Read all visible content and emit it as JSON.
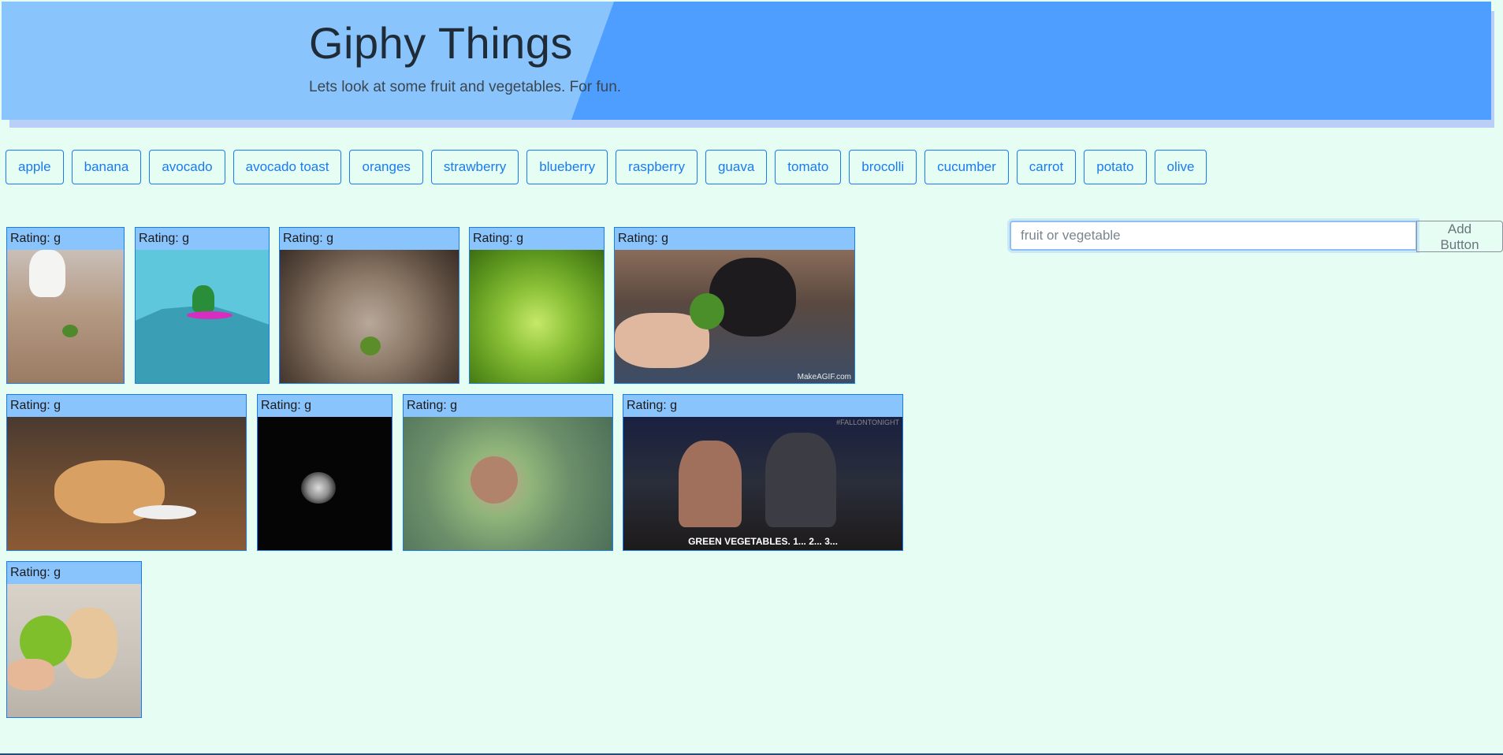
{
  "header": {
    "title": "Giphy Things",
    "subtitle": "Lets look at some fruit and vegetables. For fun."
  },
  "topics": [
    "apple",
    "banana",
    "avocado",
    "avocado toast",
    "oranges",
    "strawberry",
    "blueberry",
    "raspberry",
    "guava",
    "tomato",
    "brocolli",
    "cucumber",
    "carrot",
    "potato",
    "olive"
  ],
  "add_form": {
    "placeholder": "fruit or vegetable",
    "value": "",
    "button_label": "Add Button"
  },
  "gifs": [
    {
      "rating": "Rating: g"
    },
    {
      "rating": "Rating: g"
    },
    {
      "rating": "Rating: g"
    },
    {
      "rating": "Rating: g"
    },
    {
      "rating": "Rating: g",
      "watermark": "MakeAGIF.com"
    },
    {
      "rating": "Rating: g"
    },
    {
      "rating": "Rating: g"
    },
    {
      "rating": "Rating: g"
    },
    {
      "rating": "Rating: g",
      "caption": "GREEN VEGETABLES. 1... 2... 3...",
      "tag": "#FALLONTONIGHT"
    },
    {
      "rating": "Rating: g"
    }
  ],
  "colors": {
    "page_bg": "#e6fdf3",
    "header_light": "#8ac4fd",
    "header_dark": "#4d9efe",
    "accent": "#1a7bf0"
  }
}
